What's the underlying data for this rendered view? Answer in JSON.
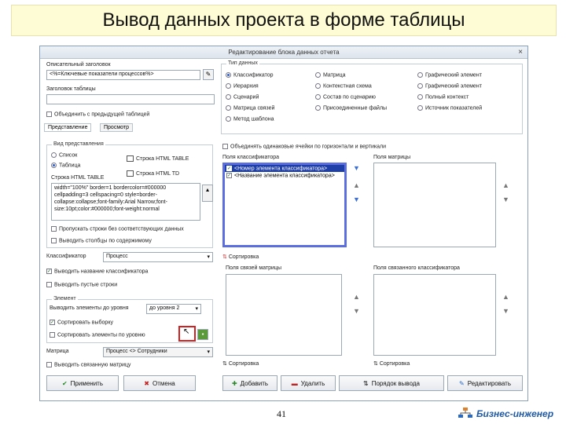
{
  "slide": {
    "title": "Вывод данных проекта в форме таблицы",
    "page_number": "41",
    "brand": "Бизнес-инженер"
  },
  "dialog": {
    "title": "Редактирование блока данных отчета",
    "close": "×",
    "left": {
      "section_label": "Описательный заголовок",
      "section_value": "<%=Ключевые показатели процессов%>",
      "name_label": "Заголовок таблицы",
      "name_value": "",
      "merge_label": "Объединить с предыдущей таблицей",
      "tabs": [
        "Представление",
        "Просмотр"
      ],
      "group_label": "Вид представления",
      "radios": [
        "Список",
        "Таблица"
      ],
      "table_btn_1": "Строка HTML TABLE",
      "table_btn_2": "Строка HTML TD",
      "html_label": "Строка HTML TABLE",
      "html_text": "width=\"100%\" border=1 bordercolor=#000000 cellpadding=3 cellspacing=0 style=border-collapse:collapse;font-family:Arial Narrow;font-size:10pt;color:#000000;font-weight:normal",
      "check_skip_empty": "Пропускать строки без соответствующих данных",
      "check_show_columns": "Выводить столбцы по содержимому",
      "classifier_label": "Классификатор",
      "classifier_value": "Процесс",
      "check_classifier_title": "Выводить название классификатора",
      "check_show_empty": "Выводить пустые строки",
      "element_group": "Элемент",
      "level_label": "Выводить элементы до уровня",
      "level_value": "до уровня 2",
      "check_sort": "Сортировать выборку",
      "check_sort_level": "Сортировать элементы по уровню",
      "matrix_label": "Матрица",
      "matrix_value": "Процесс <> Сотрудники",
      "check_show_matrix": "Выводить связанную матрицу"
    },
    "right": {
      "type_label": "Тип данных",
      "types": [
        [
          "Классификатор",
          "Матрица",
          "Графический элемент"
        ],
        [
          "Иерархия",
          "Контекстная схема",
          "Графический элемент"
        ],
        [
          "Сценарий",
          "Состав по сценарию",
          "Полный контекст"
        ],
        [
          "Матрица связей",
          "Присоединенные файлы",
          "Источник показателей"
        ],
        [
          "Метод шаблона",
          "",
          ""
        ]
      ],
      "merge_cells": "Объединять одинаковые ячейки по горизонтали и вертикали",
      "fields_label": "Поля классификатора",
      "field_items": [
        "<Номер элемента классификатора>",
        "<Название элемента классификатора>"
      ],
      "matrix_fields_label": "Поля матрицы",
      "sort_label": "Сортировка",
      "links_label": "Поля связей матрицы",
      "linked_label": "Поля связанного классификатора",
      "sort2_label": "Сортировка",
      "sort3_label": "Сортировка"
    },
    "buttons": {
      "apply": "Применить",
      "cancel": "Отмена",
      "add": "Добавить",
      "delete": "Удалить",
      "order": "Порядок вывода",
      "edit": "Редактировать"
    }
  }
}
